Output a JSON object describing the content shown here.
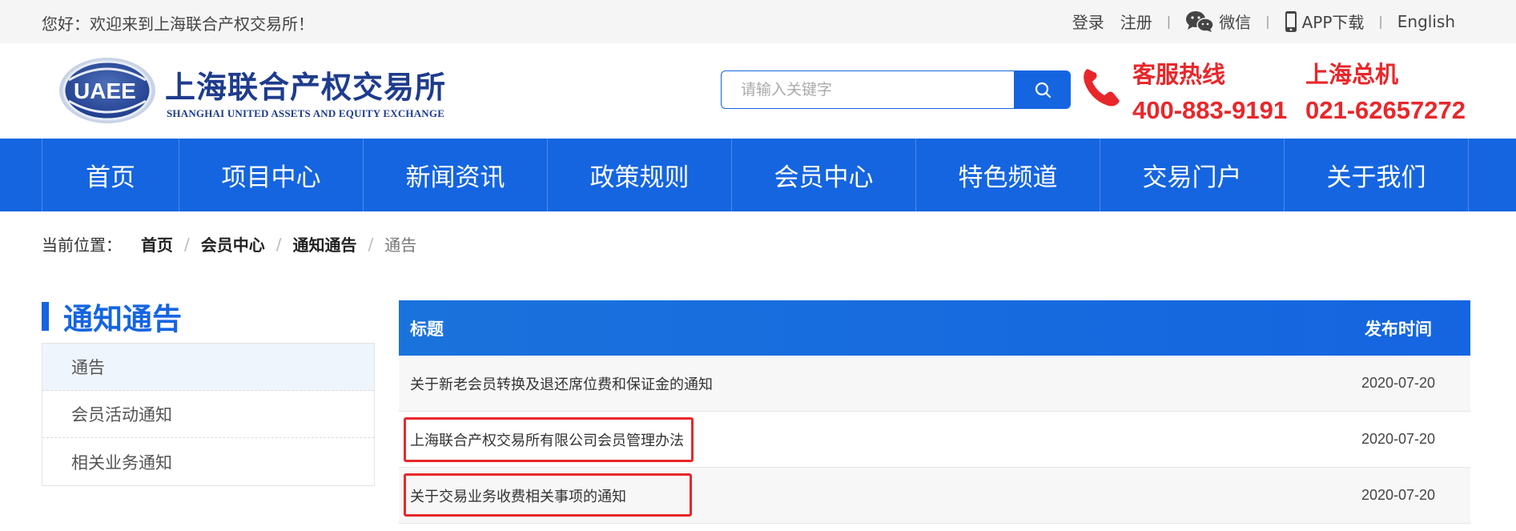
{
  "topbar": {
    "welcome": "您好：欢迎来到上海联合产权交易所！",
    "login": "登录",
    "register": "注册",
    "wechat": "微信",
    "app": "APP下载",
    "english": "English"
  },
  "header": {
    "logo_cn": "上海联合产权交易所",
    "logo_en": "SHANGHAI UNITED ASSETS AND EQUITY EXCHANGE",
    "logo_mark": "UAEE",
    "search_placeholder": "请输入关键字",
    "hotline_title": "客服热线",
    "hotline_number": "400-883-9191",
    "switchboard_title": "上海总机",
    "switchboard_number": "021-62657272"
  },
  "nav": [
    "首页",
    "项目中心",
    "新闻资讯",
    "政策规则",
    "会员中心",
    "特色频道",
    "交易门户",
    "关于我们"
  ],
  "breadcrumb": {
    "label": "当前位置：",
    "items": [
      "首页",
      "会员中心",
      "通知通告"
    ],
    "current": "通告"
  },
  "sidebar": {
    "title": "通知通告",
    "items": [
      "通告",
      "会员活动通知",
      "相关业务通知"
    ],
    "active_index": 0
  },
  "table": {
    "headers": {
      "title": "标题",
      "date": "发布时间"
    },
    "rows": [
      {
        "title": "关于新老会员转换及退还席位费和保证金的通知",
        "date": "2020-07-20",
        "highlighted": false
      },
      {
        "title": "上海联合产权交易所有限公司会员管理办法",
        "date": "2020-07-20",
        "highlighted": true
      },
      {
        "title": "关于交易业务收费相关事项的通知",
        "date": "2020-07-20",
        "highlighted": true
      }
    ]
  },
  "colors": {
    "primary_blue": "#1565e0",
    "accent_red": "#e8272b",
    "logo_navy": "#1e3c8c"
  }
}
